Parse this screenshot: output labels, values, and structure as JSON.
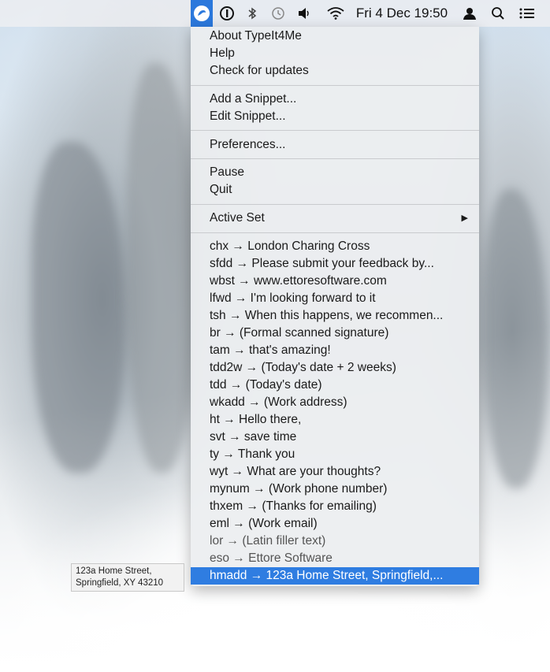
{
  "menubar": {
    "clock": "Fri 4 Dec  19:50",
    "icons": [
      "typeit4me-icon",
      "onepassword-icon",
      "bluetooth-icon",
      "time-machine-icon",
      "volume-icon",
      "wifi-icon",
      "user-icon",
      "spotlight-search-icon",
      "notification-center-icon"
    ]
  },
  "menu": {
    "group1": [
      "About TypeIt4Me",
      "Help",
      "Check for updates"
    ],
    "group2": [
      "Add a Snippet...",
      "Edit Snippet..."
    ],
    "group3": [
      "Preferences..."
    ],
    "group4": [
      "Pause",
      "Quit"
    ],
    "active_set": "Active Set",
    "snippets": [
      "chx → London Charing Cross",
      "sfdd → Please submit your feedback by...",
      "wbst → www.ettoresoftware.com",
      "lfwd → I'm looking forward to it",
      "tsh → When this happens, we recommen...",
      "br → (Formal scanned signature)",
      "tam → that's amazing!",
      "tdd2w → (Today's date + 2 weeks)",
      "tdd → (Today's date)",
      "wkadd → (Work address)",
      "ht → Hello there,",
      "svt → save time",
      "ty → Thank you",
      "wyt → What are your thoughts?",
      "mynum → (Work phone number)",
      "thxem → (Thanks for emailing)",
      "eml → (Work email)",
      "lor → (Latin filler text)",
      "eso → Ettore Software",
      "hmadd → 123a Home Street, Springfield,..."
    ],
    "selected_index": 19
  },
  "tooltip": {
    "line1": "123a Home Street,",
    "line2": "Springfield, XY 43210"
  },
  "colors": {
    "accent": "#2f7de1",
    "menubar_active": "#2b78dc"
  }
}
